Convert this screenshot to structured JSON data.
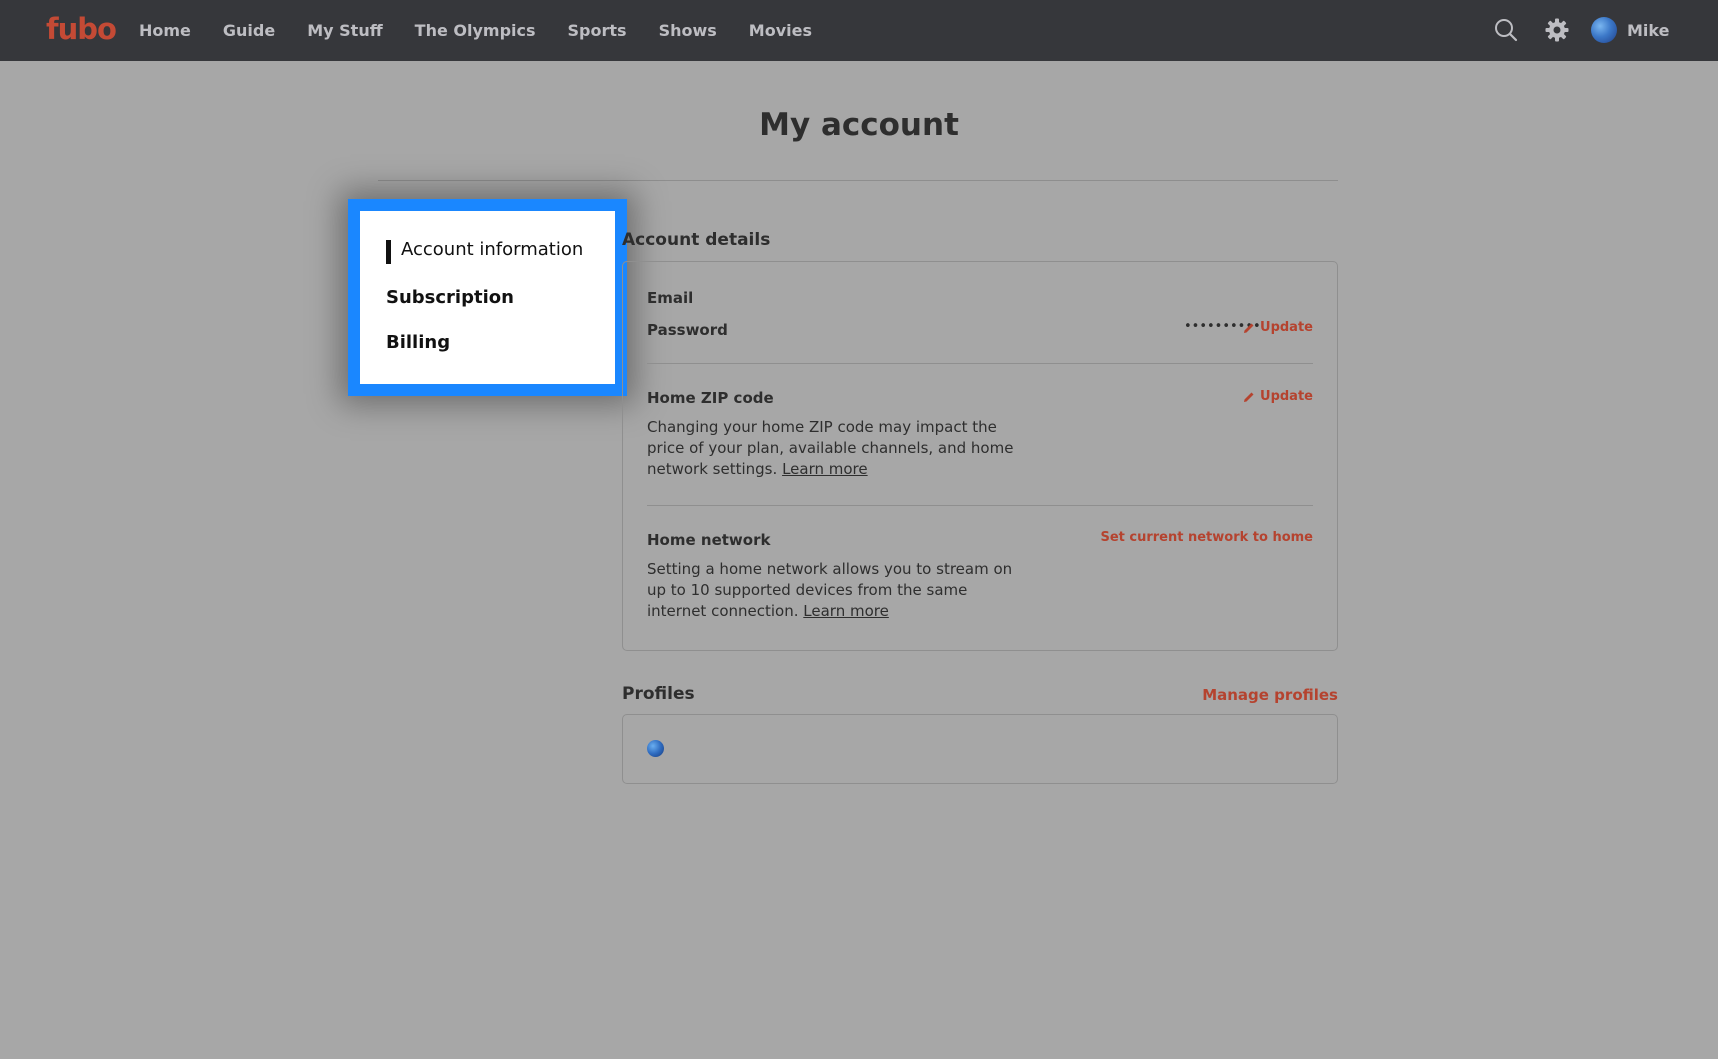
{
  "header": {
    "logo": "fubo",
    "nav": [
      "Home",
      "Guide",
      "My Stuff",
      "The Olympics",
      "Sports",
      "Shows",
      "Movies"
    ],
    "user_name": "Mike"
  },
  "page": {
    "title": "My account"
  },
  "sidebar": {
    "items": [
      {
        "label": "Account information",
        "active": true
      },
      {
        "label": "Subscription"
      },
      {
        "label": "Billing"
      }
    ]
  },
  "account_details": {
    "title": "Account details",
    "email_label": "Email",
    "password_label": "Password",
    "password_mask": "••••••••••",
    "update_label": "Update",
    "zip_label": "Home ZIP code",
    "zip_text": "Changing your home ZIP code may impact the price of your plan, available channels, and home network settings.",
    "learn_more": "Learn more",
    "network_label": "Home network",
    "network_action": "Set current network to home",
    "network_text": "Setting a home network allows you to stream on up to 10 supported devices from the same internet connection."
  },
  "profiles": {
    "title": "Profiles",
    "manage_label": "Manage profiles"
  },
  "colors": {
    "accent": "#b5432f",
    "highlight": "#1a87ff",
    "header_bg": "#36373b"
  }
}
